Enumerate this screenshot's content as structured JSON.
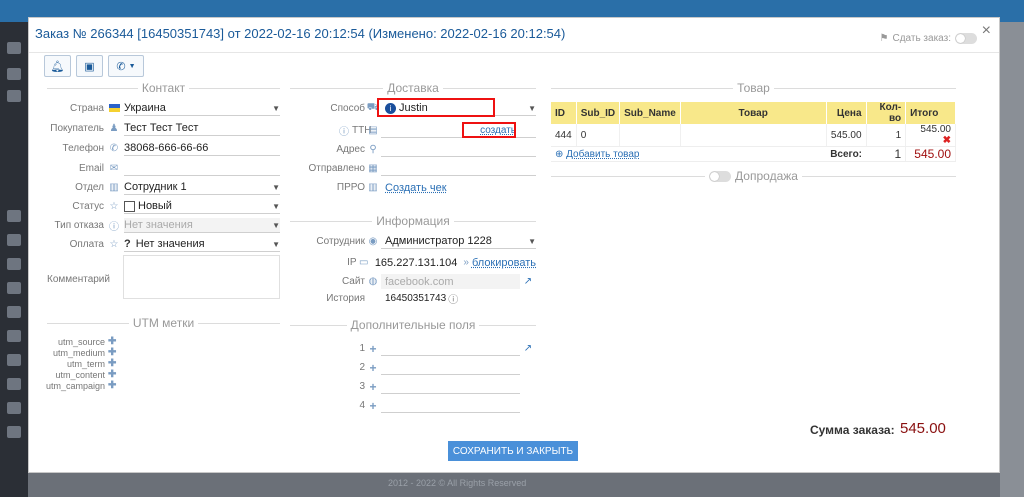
{
  "backdrop": {
    "footer_text": "2012 - 2022 © All Rights Reserved"
  },
  "modal": {
    "title": "Заказ № 266344 [16450351743] от 2022-02-16 20:12:54 (Изменено: 2022-02-16 20:12:54)",
    "hand_over_label": "Сдать заказ:",
    "close_icon": "×"
  },
  "contact": {
    "legend": "Контакт",
    "country": {
      "label": "Страна",
      "value": "Украина"
    },
    "buyer": {
      "label": "Покупатель",
      "value": "Тест Тест Тест"
    },
    "phone": {
      "label": "Телефон",
      "value": "38068-666-66-66"
    },
    "email": {
      "label": "Email",
      "value": ""
    },
    "department": {
      "label": "Отдел",
      "value": "Сотрудник 1"
    },
    "status": {
      "label": "Статус",
      "value": "Новый"
    },
    "reject_type": {
      "label": "Тип отказа",
      "value": "Нет значения"
    },
    "payment": {
      "label": "Оплата",
      "value": "Нет значения"
    },
    "comment": {
      "label": "Комментарий",
      "value": ""
    }
  },
  "utm": {
    "legend": "UTM метки",
    "items": [
      "utm_source",
      "utm_medium",
      "utm_term",
      "utm_content",
      "utm_campaign"
    ]
  },
  "delivery": {
    "legend": "Доставка",
    "method": {
      "label": "Способ",
      "value": "Justin"
    },
    "ttn": {
      "label": "ТТН",
      "link": "создать"
    },
    "address": {
      "label": "Адрес"
    },
    "sent": {
      "label": "Отправлено"
    },
    "prro": {
      "label": "ПРРО",
      "link": "Создать чек"
    }
  },
  "info": {
    "legend": "Информация",
    "employee": {
      "label": "Сотрудник",
      "value": "Администратор 1228"
    },
    "ip": {
      "label": "IP",
      "value": "165.227.131.104",
      "link": "блокировать"
    },
    "site": {
      "label": "Сайт",
      "value": "facebook.com"
    },
    "history": {
      "label": "История",
      "value": "16450351743"
    }
  },
  "extra_fields": {
    "legend": "Дополнительные поля",
    "items": [
      "1",
      "2",
      "3",
      "4"
    ]
  },
  "goods": {
    "legend": "Товар",
    "columns": [
      "ID",
      "Sub_ID",
      "Sub_Name",
      "Товар",
      "Цена",
      "Кол-во",
      "Итого"
    ],
    "rows": [
      {
        "id": "444",
        "sub_id": "0",
        "sub_name": "",
        "product": "",
        "price": "545.00",
        "qty": "1",
        "total": "545.00"
      }
    ],
    "add_link": "Добавить товар",
    "total_label": "Всего:",
    "total_qty": "1",
    "total_sum": "545.00"
  },
  "upsell": {
    "legend": "Допродажа"
  },
  "footer": {
    "save_button": "СОХРАНИТЬ И ЗАКРЫТЬ",
    "sum_label": "Сумма заказа:",
    "sum_value": "545.00"
  }
}
